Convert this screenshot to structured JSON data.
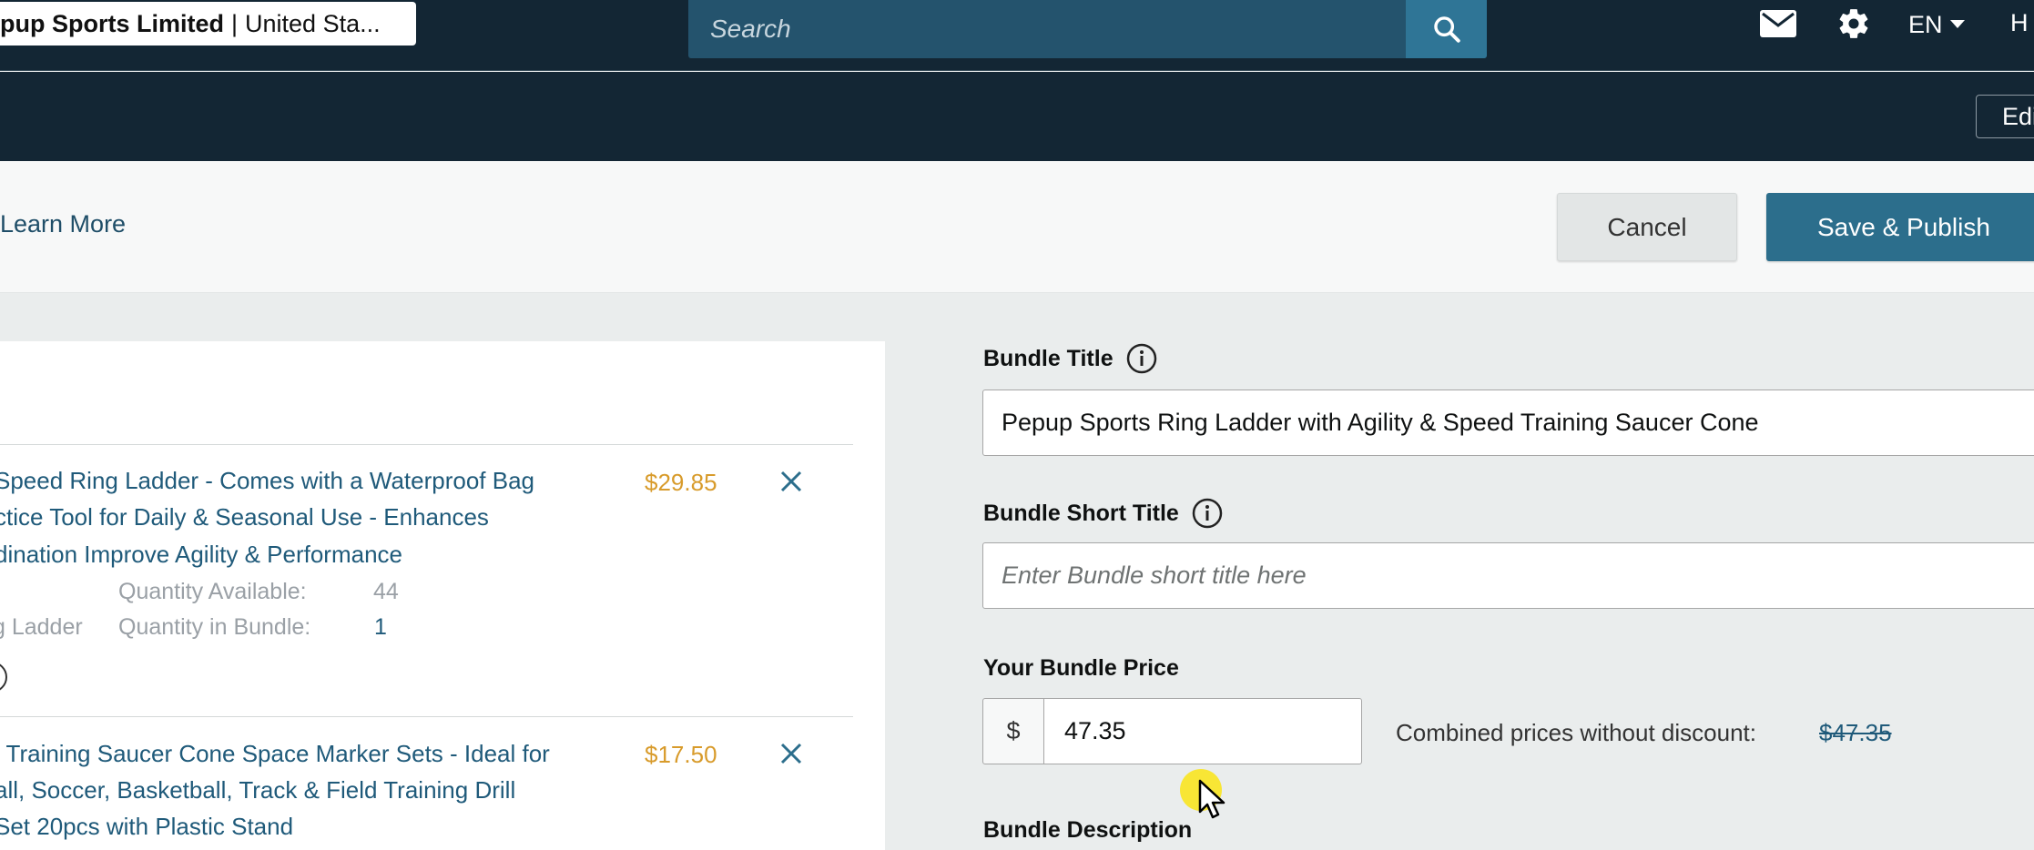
{
  "topbar": {
    "store_brand": "pup Sports Limited",
    "store_separator": "|",
    "store_region": "United Sta...",
    "search_placeholder": "Search",
    "language": "EN",
    "help_label": "H"
  },
  "subbar": {
    "edit_label": "Edi"
  },
  "actionbar": {
    "learn_more": "Learn More",
    "cancel": "Cancel",
    "save_publish": "Save & Publish"
  },
  "products": [
    {
      "title_lines": [
        "Speed Ring Ladder - Comes with a Waterproof Bag",
        "ctice Tool for Daily & Seasonal Use - Enhances",
        "dination Improve Agility & Performance"
      ],
      "price": "$29.85",
      "qty_available_label": "Quantity Available:",
      "qty_available": "44",
      "type_fragment": "g Ladder",
      "qty_bundle_label": "Quantity in Bundle:",
      "qty_bundle": "1"
    },
    {
      "title_lines": [
        "l Training Saucer Cone Space Marker Sets - Ideal for",
        "all, Soccer, Basketball, Track & Field Training Drill",
        "Set 20pcs with Plastic Stand"
      ],
      "price": "$17.50"
    }
  ],
  "form": {
    "bundle_title_label": "Bundle Title",
    "bundle_title_value": "Pepup Sports Ring Ladder with Agility & Speed Training Saucer Cone",
    "short_title_label": "Bundle Short Title",
    "short_title_placeholder": "Enter Bundle short title here",
    "price_label": "Your Bundle Price",
    "currency": "$",
    "price_value": "47.35",
    "combined_label": "Combined prices without discount:",
    "combined_value": "$47.35",
    "description_label": "Bundle Description"
  },
  "icons": {
    "search": "search-icon",
    "mail": "mail-icon",
    "gear": "gear-icon",
    "caret": "chevron-down-icon",
    "info": "info-icon",
    "remove": "close-icon",
    "cursor": "mouse-cursor-icon"
  },
  "colors": {
    "nav_bg": "#132634",
    "search_bg": "#24536d",
    "primary_button": "#2c6e8c",
    "link": "#1f5a7a",
    "price": "#d89b2b"
  }
}
